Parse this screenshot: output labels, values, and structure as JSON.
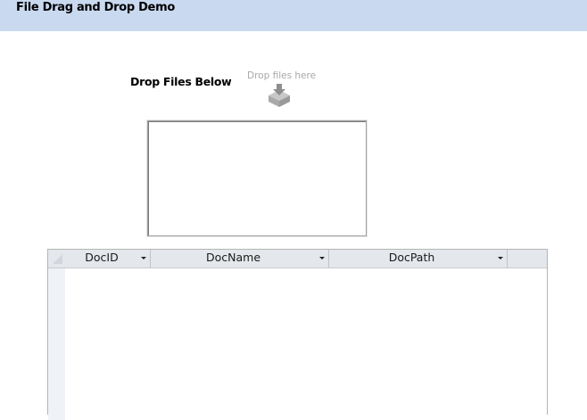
{
  "header": {
    "title": "File Drag and Drop Demo"
  },
  "drop_zone": {
    "label": "Drop Files Below",
    "hint": "Drop files here",
    "icon": "drop-tray-icon"
  },
  "datasheet": {
    "columns": [
      {
        "label": "DocID"
      },
      {
        "label": "DocName"
      },
      {
        "label": "DocPath"
      }
    ],
    "rows": []
  },
  "colors": {
    "header_bg": "#c9d9ef",
    "datasheet_header_bg": "#e4e7eb",
    "hint_text": "#a8a8a8"
  }
}
